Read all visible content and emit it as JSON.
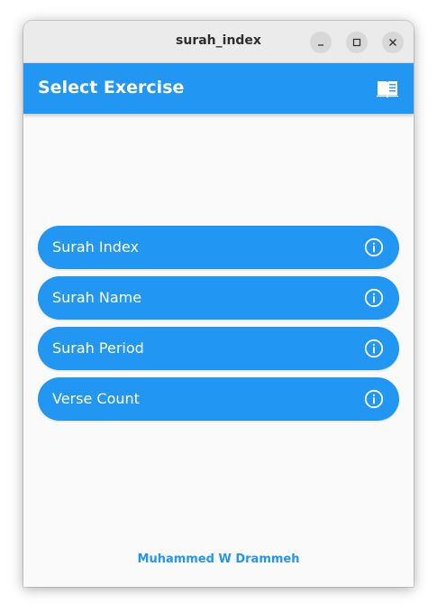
{
  "window": {
    "title": "surah_index"
  },
  "appbar": {
    "title": "Select Exercise",
    "icon": "book-icon",
    "color": "#2196f3"
  },
  "menu": {
    "items": [
      {
        "label": "Surah Index",
        "icon": "info-icon"
      },
      {
        "label": "Surah Name",
        "icon": "info-icon"
      },
      {
        "label": "Surah Period",
        "icon": "info-icon"
      },
      {
        "label": "Verse Count",
        "icon": "info-icon"
      }
    ]
  },
  "footer": {
    "author": "Muhammed W Drammeh"
  },
  "colors": {
    "accent": "#2196f3",
    "background": "#fafafa"
  }
}
